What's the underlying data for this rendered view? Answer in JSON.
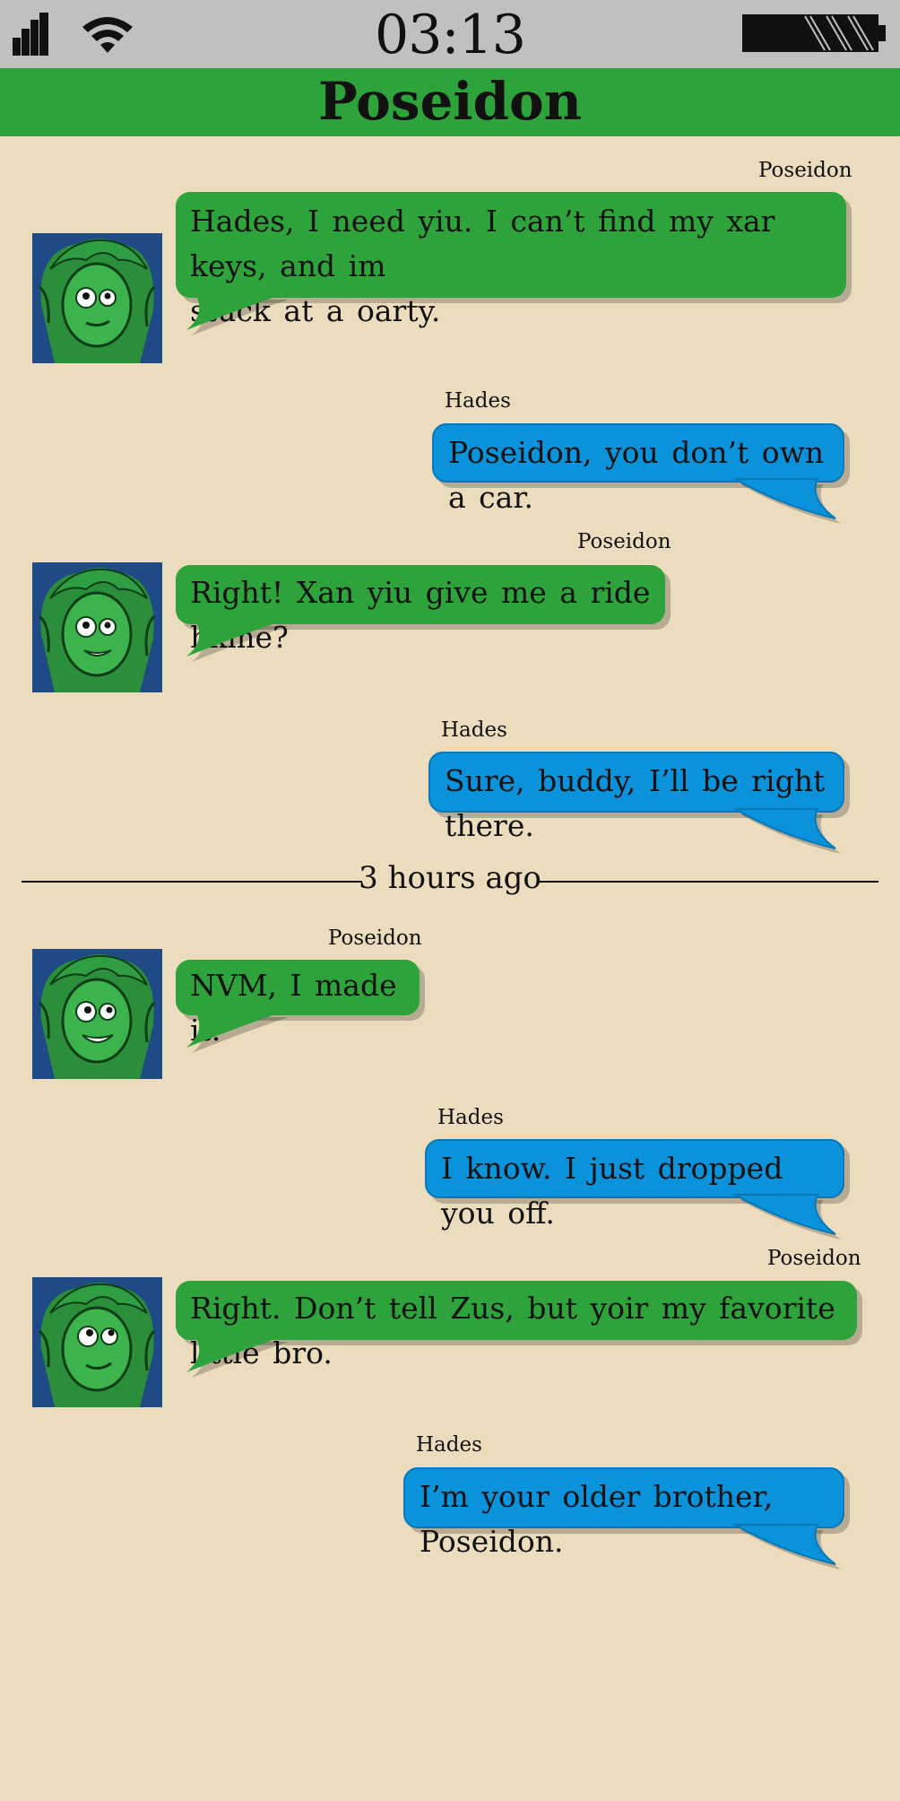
{
  "status_bar": {
    "time": "03:13"
  },
  "header": {
    "title": "Poseidon"
  },
  "messages": [
    {
      "sender": "Poseidon",
      "lines": [
        "Hades, I need yiu. I can’t find my xar keys, and im",
        "stuck at a oarty."
      ]
    },
    {
      "sender": "Hades",
      "lines": [
        "Poseidon, you don’t own a car."
      ]
    },
    {
      "sender": "Poseidon",
      "lines": [
        "Right! Xan yiu give me a ride hkme?"
      ]
    },
    {
      "sender": "Hades",
      "lines": [
        "Sure, buddy, I’ll be right there."
      ]
    },
    {
      "sender": "Poseidon",
      "lines": [
        "NVM, I made it."
      ]
    },
    {
      "sender": "Hades",
      "lines": [
        "I know. I just dropped you off."
      ]
    },
    {
      "sender": "Poseidon",
      "lines": [
        "Right. Don’t tell Zus, but yoir my favorite little bro."
      ]
    },
    {
      "sender": "Hades",
      "lines": [
        "I’m your older brother, Poseidon."
      ]
    }
  ],
  "divider": {
    "label": "3 hours ago"
  },
  "colors": {
    "background": "#ecdcbe",
    "header": "#2ea33b",
    "poseidon_bubble": "#2ea33b",
    "hades_bubble": "#0a92da",
    "status_bar": "#c0c0c0"
  },
  "icons": [
    "signal-icon",
    "wifi-icon",
    "battery-icon",
    "avatar-poseidon"
  ]
}
